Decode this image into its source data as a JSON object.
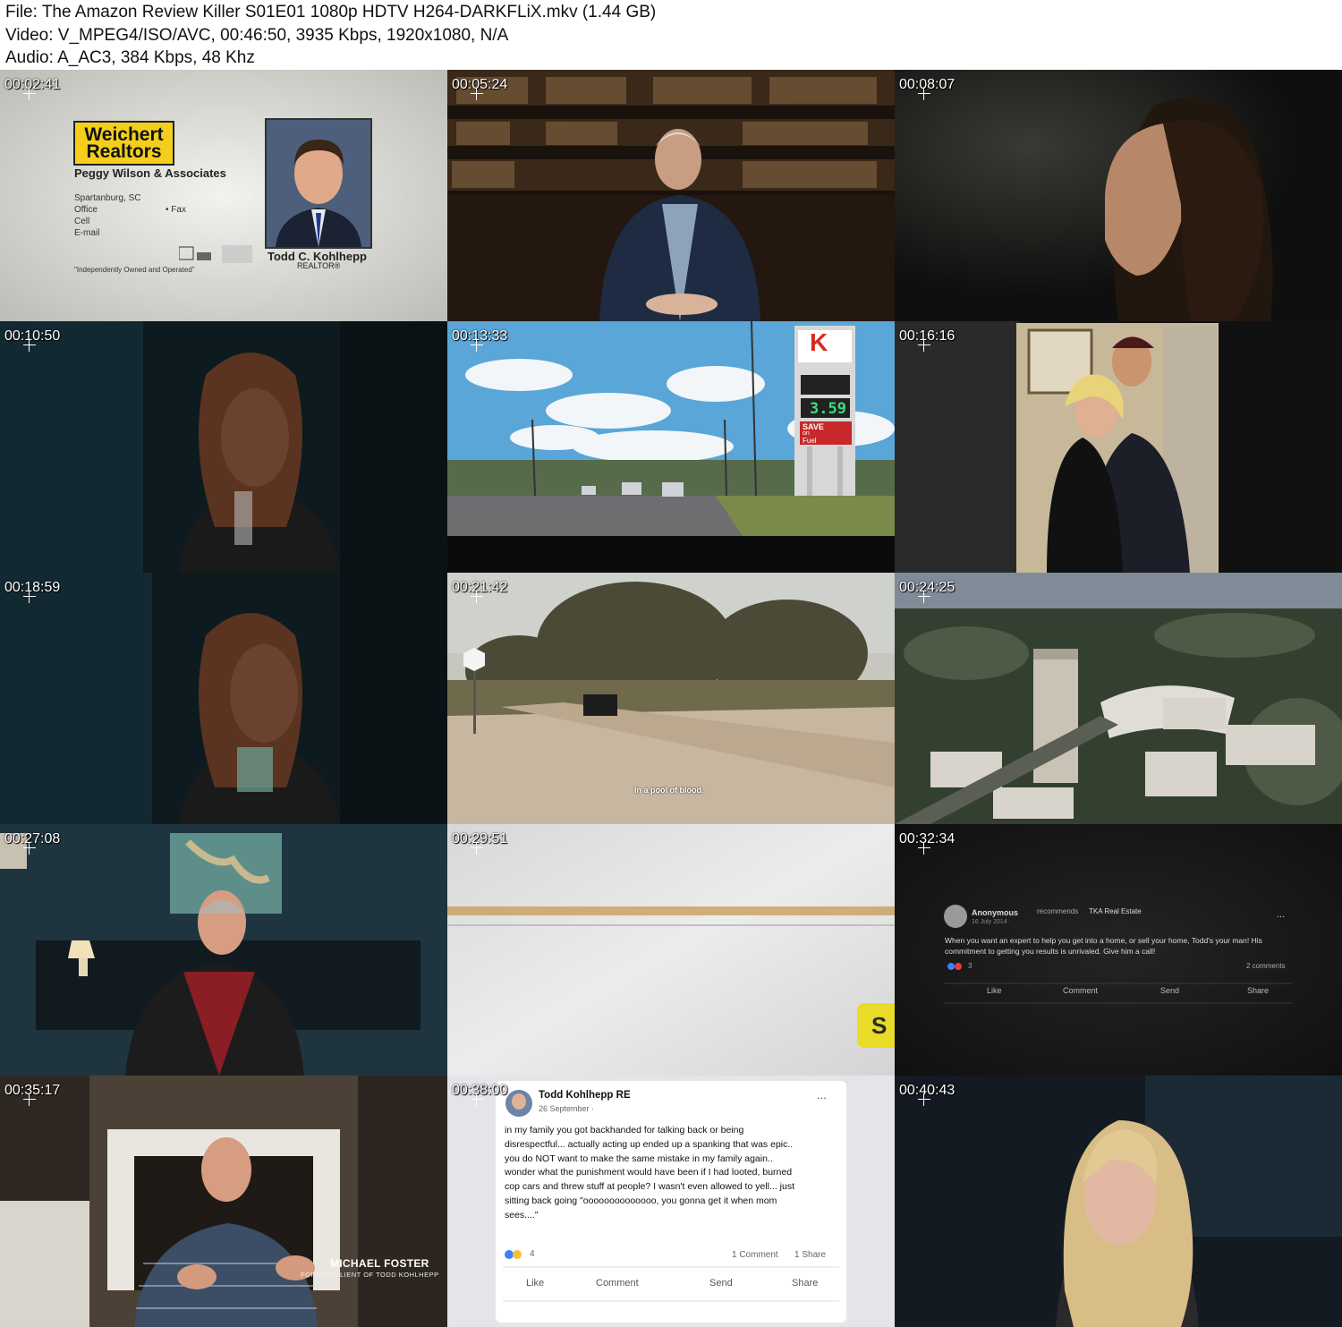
{
  "header": {
    "file_line": "File: The Amazon Review Killer S01E01 1080p HDTV H264-DARKFLiX.mkv (1.44 GB)",
    "video_line": "Video: V_MPEG4/ISO/AVC, 00:46:50, 3935 Kbps, 1920x1080, N/A",
    "audio_line": "Audio: A_AC3, 384 Kbps, 48 Khz"
  },
  "thumbnails": [
    {
      "timestamp": "00:02:41"
    },
    {
      "timestamp": "00:05:24"
    },
    {
      "timestamp": "00:08:07"
    },
    {
      "timestamp": "00:10:50"
    },
    {
      "timestamp": "00:13:33"
    },
    {
      "timestamp": "00:16:16"
    },
    {
      "timestamp": "00:18:59"
    },
    {
      "timestamp": "00:21:42"
    },
    {
      "timestamp": "00:24:25"
    },
    {
      "timestamp": "00:27:08"
    },
    {
      "timestamp": "00:29:51"
    },
    {
      "timestamp": "00:32:34"
    },
    {
      "timestamp": "00:35:17"
    },
    {
      "timestamp": "00:38:00"
    },
    {
      "timestamp": "00:40:43"
    }
  ],
  "card": {
    "logo_line1": "Weichert",
    "logo_line2": "Realtors",
    "company": "Peggy Wilson & Associates",
    "city": "Spartanburg, SC",
    "office": "Office",
    "fax": "• Fax",
    "cell": "Cell",
    "email": "E-mail",
    "footer": "\"Independently Owned and Operated\"",
    "name": "Todd C. Kohlhepp",
    "title": "REALTOR®"
  },
  "gas_sign": {
    "logo": "K",
    "price": "3.59",
    "promo1": "SAVE",
    "promo2": "on",
    "promo3": "Fuel"
  },
  "subtitle_road": "In a pool of blood.",
  "partial_button_text": "S",
  "fb_dark": {
    "author": "Anonymous",
    "recommends": "recommends",
    "page": "TKA Real Estate",
    "date": "16 July 2014 · ",
    "menu": "...",
    "body": "When you want an expert to help you get into a home, or sell your home, Todd's your man! His commitment to getting you results is unrivaled. Give him a call!",
    "reactions": "3",
    "comments": "2 comments",
    "like": "Like",
    "comment": "Comment",
    "send": "Send",
    "share": "Share"
  },
  "lower_third": {
    "name": "MICHAEL FOSTER",
    "role": "FORMER CLIENT OF TODD KOHLHEPP"
  },
  "fb_light": {
    "author": "Todd Kohlhepp RE",
    "date": "26 September · ",
    "menu": "...",
    "lines": [
      "in my family you got backhanded for talking back or being",
      "disrespectful... actually acting up ended up a spanking that was epic..",
      "you do NOT want to make the same mistake in my family again..",
      "wonder what the punishment would have been if I had looted, burned",
      "cop cars and threw stuff at people? I wasn't even allowed to yell... just",
      "sitting back going \"oooooooooooooo, you gonna get it when mom",
      "sees....\""
    ],
    "reactions": "4",
    "comment_count": "1 Comment",
    "share_count": "1 Share",
    "like": "Like",
    "comment": "Comment",
    "send": "Send",
    "share": "Share"
  }
}
